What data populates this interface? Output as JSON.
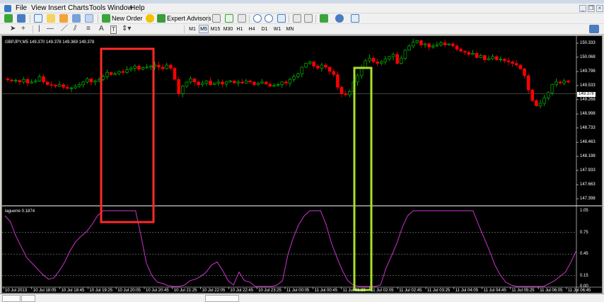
{
  "menu": {
    "items": [
      "File",
      "View",
      "Insert",
      "Charts",
      "Tools",
      "Window",
      "Help"
    ]
  },
  "toolbar": {
    "new_order_label": "New Order",
    "expert_advisors_label": "Expert Advisors",
    "text_tool_label": "A",
    "timeframes": [
      "M1",
      "M5",
      "M15",
      "M30",
      "H1",
      "H4",
      "D1",
      "W1",
      "MN"
    ],
    "selected_timeframe": "M5"
  },
  "chart": {
    "symbol_header": "GBPJPY,M5  149.370 149.378 149.369 149.378",
    "indicator_label": "laguerre 0.1874",
    "current_price": "149.378",
    "colors": {
      "background": "#000000",
      "bull": "#00cc00",
      "bear": "#ff0000",
      "indicator": "#cc33cc",
      "highlight_red": "#ff2a2a",
      "highlight_green": "#a8e02a"
    },
    "price_axis": [
      "150.333",
      "150.068",
      "149.798",
      "149.533",
      "149.268",
      "148.998",
      "148.733",
      "148.463",
      "148.198",
      "147.933",
      "147.663",
      "147.398"
    ],
    "indicator_axis": [
      "1.05",
      "0.75",
      "0.45",
      "0.15",
      "0.00"
    ],
    "time_axis": [
      "10 Jul 2013",
      "10 Jul 18:05",
      "10 Jul 18:45",
      "10 Jul 19:25",
      "10 Jul 20:05",
      "10 Jul 20:45",
      "10 Jul 21:25",
      "10 Jul 22:05",
      "10 Jul 22:45",
      "10 Jul 23:25",
      "11 Jul 00:05",
      "11 Jul 00:45",
      "11 Jul 01:25",
      "11 Jul 02:05",
      "11 Jul 02:45",
      "11 Jul 03:25",
      "11 Jul 04:05",
      "11 Jul 04:45",
      "11 Jul 05:25",
      "11 Jul 06:05",
      "11 Jul 06:45"
    ],
    "closes": [
      149.64,
      149.62,
      149.63,
      149.6,
      149.65,
      149.58,
      149.6,
      149.62,
      149.7,
      149.6,
      149.55,
      149.54,
      149.52,
      149.55,
      149.5,
      149.48,
      149.49,
      149.52,
      149.55,
      149.6,
      149.66,
      149.6,
      149.62,
      149.65,
      149.7,
      149.78,
      149.74,
      149.76,
      149.8,
      149.78,
      149.83,
      149.86,
      149.9,
      149.84,
      149.87,
      149.88,
      149.9,
      149.92,
      149.88,
      149.85,
      149.92,
      149.86,
      149.65,
      149.38,
      149.52,
      149.6,
      149.66,
      149.6,
      149.55,
      149.58,
      149.62,
      149.55,
      149.58,
      149.6,
      149.56,
      149.6,
      149.62,
      149.58,
      149.6,
      149.58,
      149.62,
      149.6,
      149.55,
      149.58,
      149.6,
      149.56,
      149.52,
      149.54,
      149.55,
      149.6,
      149.58,
      149.65,
      149.7,
      149.75,
      149.88,
      149.95,
      149.98,
      149.9,
      149.86,
      149.92,
      149.88,
      149.8,
      149.74,
      149.5,
      149.38,
      149.36,
      149.42,
      149.6,
      149.72,
      149.88,
      150.0,
      150.05,
      149.98,
      149.95,
      149.98,
      150.03,
      150.08,
      150.12,
      149.95,
      150.05,
      150.2,
      150.28,
      150.35,
      150.38,
      150.3,
      150.32,
      150.26,
      150.28,
      150.3,
      150.34,
      150.3,
      150.32,
      150.28,
      150.22,
      150.18,
      150.16,
      150.12,
      150.14,
      150.06,
      150.1,
      150.02,
      150.04,
      150.08,
      150.02,
      150.03,
      150.0,
      149.98,
      149.95,
      149.92,
      149.85,
      149.72,
      149.45,
      149.25,
      149.15,
      149.2,
      149.3,
      149.4,
      149.55,
      149.6,
      149.58,
      149.62,
      149.6
    ],
    "indicator": [
      0.98,
      0.9,
      0.7,
      0.55,
      0.4,
      0.32,
      0.24,
      0.16,
      0.1,
      0.12,
      0.22,
      0.34,
      0.5,
      0.62,
      0.7,
      0.76,
      0.86,
      0.98,
      1.05,
      1.05,
      1.05,
      1.05,
      1.05,
      1.05,
      1.05,
      0.7,
      0.32,
      0.15,
      0.06,
      0.04,
      0.01,
      0.0,
      0.0,
      0.02,
      0.08,
      0.1,
      0.14,
      0.2,
      0.3,
      0.34,
      0.22,
      0.08,
      0.02,
      0.2,
      0.08,
      0.06,
      0.0,
      0.0,
      0.0,
      0.0,
      0.02,
      0.08,
      0.45,
      0.68,
      0.86,
      0.98,
      1.05,
      1.05,
      1.05,
      0.86,
      0.6,
      0.4,
      0.22,
      0.08,
      0.02,
      0.0,
      0.0,
      0.0,
      0.0,
      0.02,
      0.25,
      0.42,
      0.6,
      0.82,
      0.98,
      1.05,
      1.05,
      1.05,
      1.05,
      1.05,
      1.05,
      1.05,
      1.05,
      1.05,
      1.05,
      1.05,
      1.05,
      0.86,
      0.68,
      0.5,
      0.3,
      0.16,
      0.06,
      0.02,
      0.0,
      0.0,
      0.0,
      0.0,
      0.0,
      0.0,
      0.04,
      0.08,
      0.14,
      0.2,
      0.34,
      0.5
    ]
  }
}
